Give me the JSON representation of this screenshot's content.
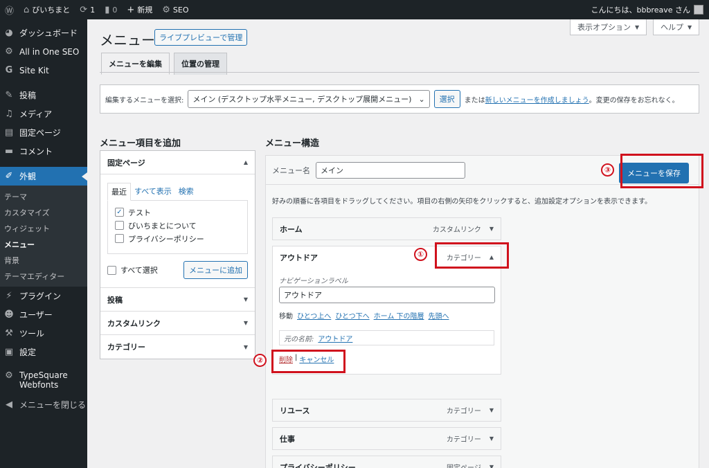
{
  "adminbar": {
    "site_name": "びいちまと",
    "updates": "1",
    "comments": "0",
    "new_label": "新規",
    "seo_label": "SEO",
    "greeting": "こんにちは、bbbreave さん"
  },
  "sidebar": {
    "items": [
      {
        "label": "ダッシュボード",
        "icon": "dashboard-icon"
      },
      {
        "label": "All in One SEO",
        "icon": "gear-icon"
      },
      {
        "label": "Site Kit",
        "icon": "g-icon"
      },
      {
        "label": "投稿",
        "icon": "pin-icon"
      },
      {
        "label": "メディア",
        "icon": "media-icon"
      },
      {
        "label": "固定ページ",
        "icon": "page-icon"
      },
      {
        "label": "コメント",
        "icon": "comment-icon"
      },
      {
        "label": "外観",
        "icon": "brush-icon"
      },
      {
        "label": "プラグイン",
        "icon": "plugin-icon"
      },
      {
        "label": "ユーザー",
        "icon": "user-icon"
      },
      {
        "label": "ツール",
        "icon": "wrench-icon"
      },
      {
        "label": "設定",
        "icon": "settings-icon"
      },
      {
        "label": "TypeSquare Webfonts",
        "icon": "gear-icon"
      },
      {
        "label": "メニューを閉じる",
        "icon": "collapse-icon"
      }
    ],
    "submenu": [
      "テーマ",
      "カスタマイズ",
      "ウィジェット",
      "メニュー",
      "背景",
      "テーマエディター"
    ]
  },
  "screen_options": "表示オプション",
  "help": "ヘルプ",
  "page_title": "メニュー",
  "live_preview": "ライブプレビューで管理",
  "tabs": [
    "メニューを編集",
    "位置の管理"
  ],
  "select_bar": {
    "label": "編集するメニューを選択:",
    "selected": "メイン (デスクトップ水平メニュー, デスクトップ展開メニュー)",
    "select_btn": "選択",
    "or_text": "または",
    "create_link": "新しいメニューを作成しましょう",
    "after_text": "。変更の保存をお忘れなく。"
  },
  "add_items": {
    "heading": "メニュー項目を追加",
    "pages_title": "固定ページ",
    "subtabs": [
      "最近",
      "すべて表示",
      "検索"
    ],
    "pages": [
      {
        "label": "テスト",
        "checked": true
      },
      {
        "label": "びいちまとについて",
        "checked": false
      },
      {
        "label": "プライバシーポリシー",
        "checked": false
      }
    ],
    "select_all": "すべて選択",
    "add_btn": "メニューに追加",
    "other_sections": [
      "投稿",
      "カスタムリンク",
      "カテゴリー"
    ]
  },
  "structure": {
    "heading": "メニュー構造",
    "name_label": "メニュー名",
    "name_value": "メイン",
    "save_btn": "メニューを保存",
    "description": "好みの順番に各項目をドラッグしてください。項目の右側の矢印をクリックすると、追加設定オプションを表示できます。",
    "items": [
      {
        "title": "ホーム",
        "type": "カスタムリンク"
      },
      {
        "title": "アウトドア",
        "type": "カテゴリー"
      },
      {
        "title": "リユース",
        "type": "カテゴリー"
      },
      {
        "title": "仕事",
        "type": "カテゴリー"
      },
      {
        "title": "プライバシーポリシー",
        "type": "固定ページ"
      }
    ],
    "expanded": {
      "nav_label": "ナビゲーションラベル",
      "nav_value": "アウトドア",
      "move_label": "移動",
      "move_links": [
        "ひとつ上へ",
        "ひとつ下へ",
        "ホーム 下の階層",
        "先頭へ"
      ],
      "orig_label": "元の名前:",
      "orig_link": "アウトドア",
      "delete": "削除",
      "sep": "|",
      "cancel": "キャンセル"
    }
  },
  "annotations": [
    "①",
    "②",
    "③"
  ]
}
